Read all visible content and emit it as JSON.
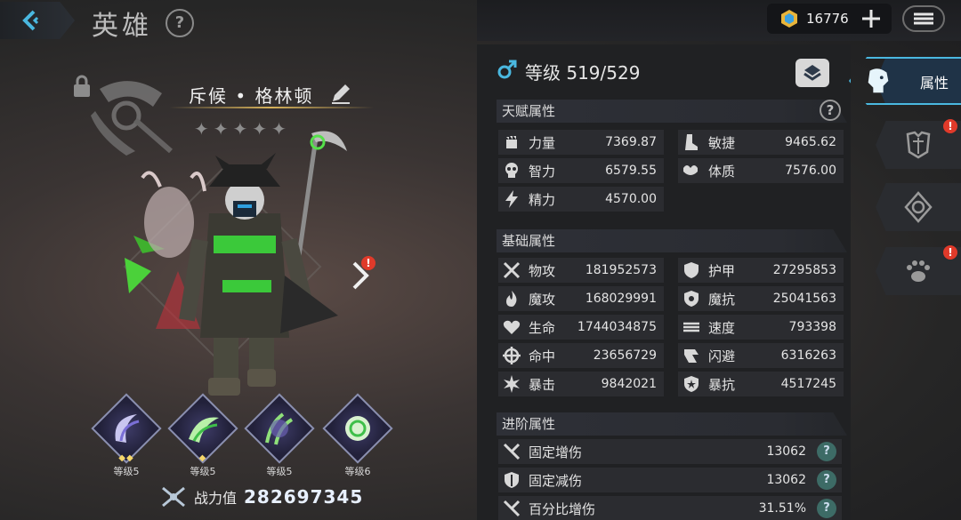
{
  "header": {
    "title": "英雄",
    "help_glyph": "?"
  },
  "currency": {
    "gems": "16776"
  },
  "hero": {
    "name": "斥候 • 格林顿",
    "stars": 5
  },
  "skills": [
    {
      "level": "等级5",
      "pips": "◆◆"
    },
    {
      "level": "等级5",
      "pips": "◆"
    },
    {
      "level": "等级5",
      "pips": ""
    },
    {
      "level": "等级6",
      "pips": ""
    }
  ],
  "power": {
    "label": "战力值",
    "value": "282697345"
  },
  "level": {
    "text": "等级 519/529"
  },
  "sections": {
    "talent": "天赋属性",
    "basic": "基础属性",
    "advanced": "进阶属性"
  },
  "talent_stats": [
    {
      "label": "力量",
      "value": "7369.87",
      "icon": "fist-icon"
    },
    {
      "label": "敏捷",
      "value": "9465.62",
      "icon": "boot-icon"
    },
    {
      "label": "智力",
      "value": "6579.55",
      "icon": "skull-icon"
    },
    {
      "label": "体质",
      "value": "7576.00",
      "icon": "muscle-icon"
    },
    {
      "label": "精力",
      "value": "4570.00",
      "icon": "lightning-icon"
    }
  ],
  "basic_stats": [
    {
      "label": "物攻",
      "value": "181952573",
      "icon": "swords-icon"
    },
    {
      "label": "护甲",
      "value": "27295853",
      "icon": "shield-icon"
    },
    {
      "label": "魔攻",
      "value": "168029991",
      "icon": "flame-icon"
    },
    {
      "label": "魔抗",
      "value": "25041563",
      "icon": "magic-shield-icon"
    },
    {
      "label": "生命",
      "value": "1744034875",
      "icon": "heart-icon"
    },
    {
      "label": "速度",
      "value": "793398",
      "icon": "speed-icon"
    },
    {
      "label": "命中",
      "value": "23656729",
      "icon": "crosshair-icon"
    },
    {
      "label": "闪避",
      "value": "6316263",
      "icon": "dodge-icon"
    },
    {
      "label": "暴击",
      "value": "9842021",
      "icon": "crit-icon"
    },
    {
      "label": "暴抗",
      "value": "4517245",
      "icon": "crit-resist-icon"
    }
  ],
  "advanced_stats": [
    {
      "label": "固定增伤",
      "value": "13062"
    },
    {
      "label": "固定减伤",
      "value": "13062"
    },
    {
      "label": "百分比增伤",
      "value": "31.51%"
    }
  ],
  "tabs": {
    "attributes": "属性"
  },
  "badge": "!",
  "colors": {
    "accent": "#4ab8e0",
    "power": "#e8f0ff",
    "alert": "#e03a2a"
  }
}
